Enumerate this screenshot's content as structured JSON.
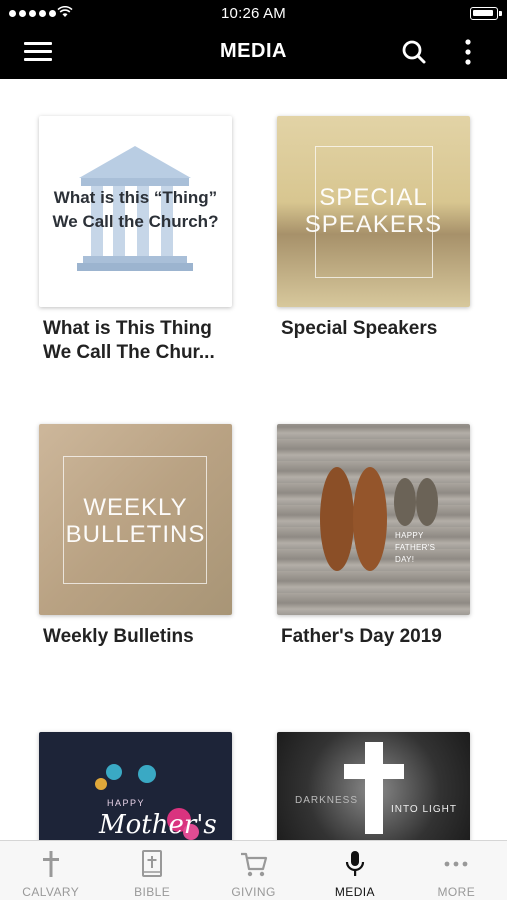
{
  "status": {
    "time": "10:26 AM"
  },
  "nav": {
    "title": "MEDIA"
  },
  "cards": [
    {
      "title": "What is This Thing We Call The Chur...",
      "image_text_1": "What is this “Thing”",
      "image_text_2": "We Call the Church?"
    },
    {
      "title": "Special Speakers",
      "image_text_1": "SPECIAL",
      "image_text_2": "SPEAKERS"
    },
    {
      "title": "Weekly Bulletins",
      "image_text_1": "WEEKLY",
      "image_text_2": "BULLETINS"
    },
    {
      "title": "Father's Day 2019",
      "image_text_1": "HAPPY",
      "image_text_2": "FATHER'S",
      "image_text_3": "DAY!"
    },
    {
      "title": "",
      "image_text_1": "HAPPY",
      "image_text_2": "Mother's"
    },
    {
      "title": "",
      "image_text_1": "DARKNESS",
      "image_text_2": "INTO LIGHT"
    }
  ],
  "tabs": [
    {
      "label": "CALVARY",
      "icon": "cross-icon",
      "active": false
    },
    {
      "label": "BIBLE",
      "icon": "bible-icon",
      "active": false
    },
    {
      "label": "GIVING",
      "icon": "cart-icon",
      "active": false
    },
    {
      "label": "MEDIA",
      "icon": "microphone-icon",
      "active": true
    },
    {
      "label": "MORE",
      "icon": "ellipsis-icon",
      "active": false
    }
  ],
  "colors": {
    "bar": "#000000",
    "active_tab": "#111111",
    "inactive_tab": "#999999"
  }
}
